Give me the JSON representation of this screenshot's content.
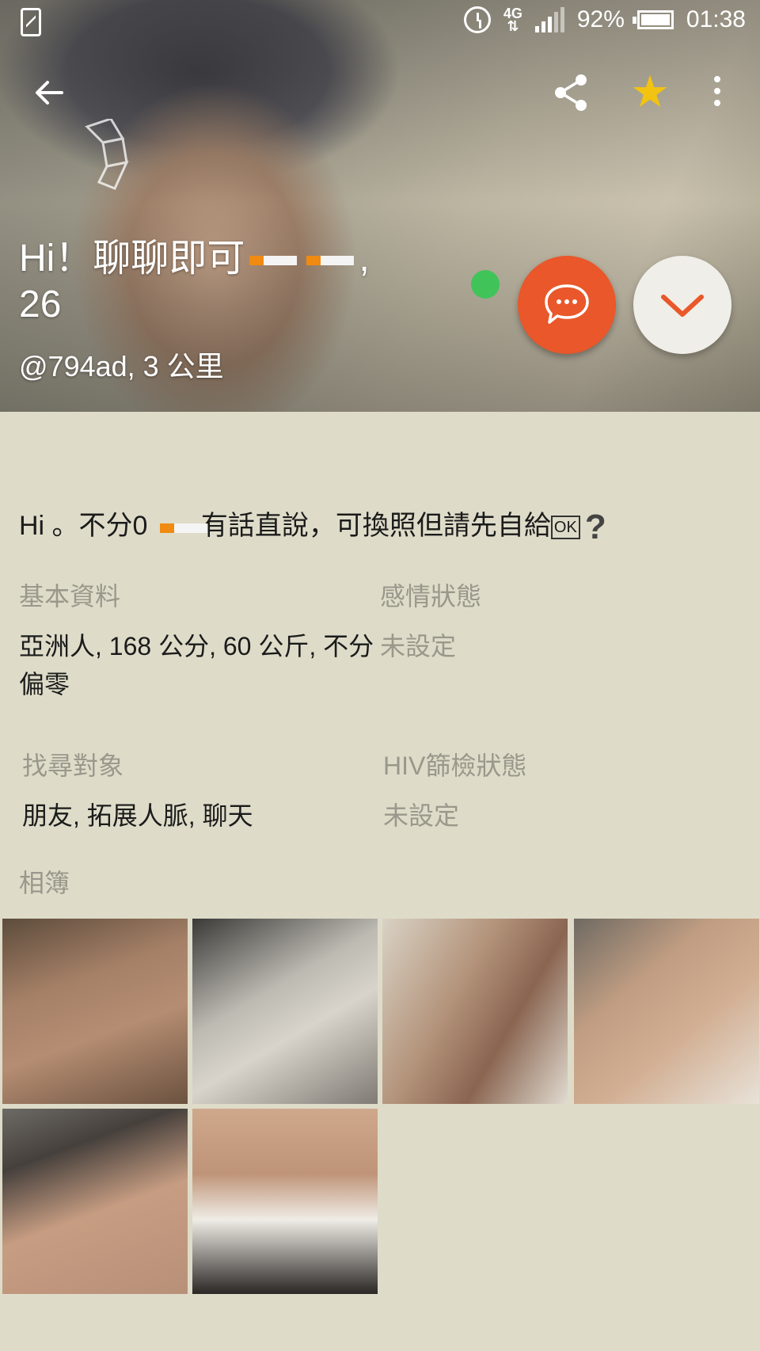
{
  "status_bar": {
    "network": "4G",
    "battery": "92%",
    "time": "01:38"
  },
  "profile": {
    "name_prefix": "Hi！聊聊即可",
    "name_suffix": ",",
    "age": "26",
    "handle_distance": "@794ad, 3 公里",
    "online": true
  },
  "bio": {
    "part1": "Hi 。不分0 ",
    "part2": "有話直說，可換照但請先自給",
    "ok_badge": "OK",
    "question": "?"
  },
  "sections": {
    "basic_label": "基本資料",
    "basic_value": "亞洲人, 168 公分, 60 公斤, 不分偏零",
    "relationship_label": "感情狀態",
    "relationship_value": "未設定",
    "looking_label": "找尋對象",
    "looking_value": "朋友, 拓展人脈, 聊天",
    "hiv_label": "HIV篩檢狀態",
    "hiv_value": "未設定",
    "album_label": "相簿"
  },
  "colors": {
    "accent_orange": "#e9572a",
    "star_yellow": "#f2c311",
    "online_green": "#40c45a",
    "background": "#dedcc9"
  },
  "icons": [
    "back-arrow-icon",
    "share-icon",
    "star-icon",
    "more-vertical-icon",
    "chat-bubble-icon",
    "chevron-down-icon"
  ],
  "album": {
    "photos": [
      "photo-1",
      "photo-2",
      "photo-3",
      "photo-4",
      "photo-5",
      "photo-6"
    ]
  }
}
